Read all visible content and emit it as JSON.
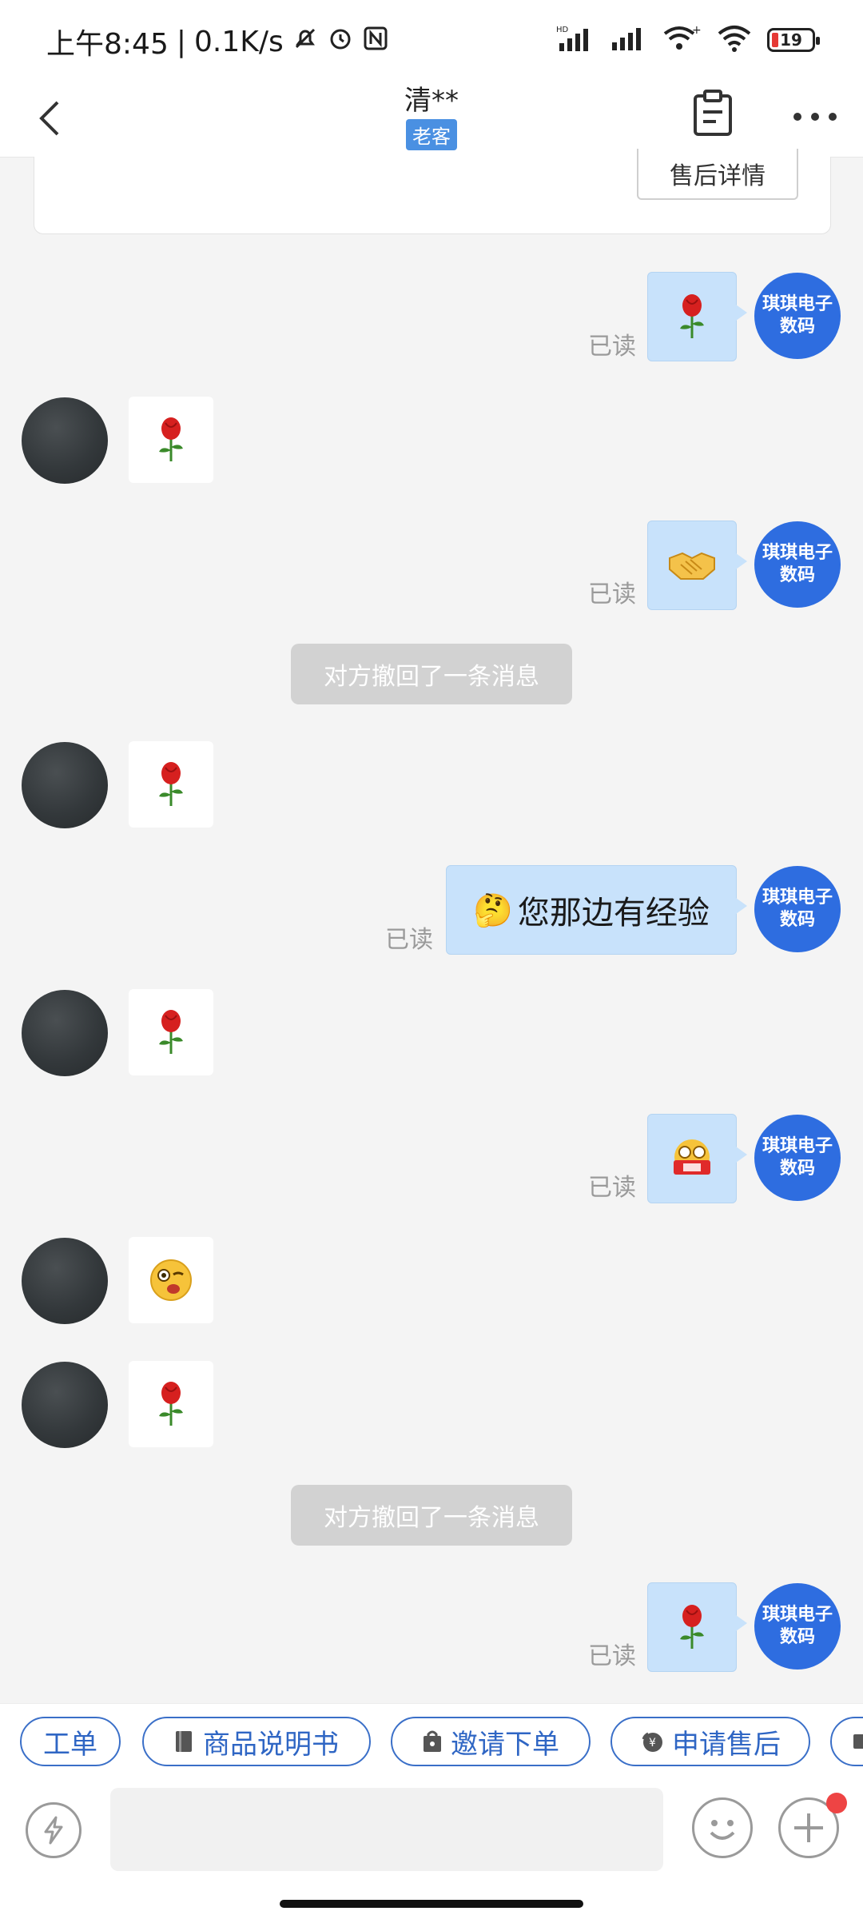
{
  "status_bar": {
    "time": "上午8:45",
    "speed": "0.1K/s",
    "network_label": "HD",
    "battery": "19"
  },
  "header": {
    "title": "清**",
    "badge": "老客"
  },
  "top_card": {
    "button_label": "售后详情"
  },
  "messages": {
    "me_avatar_line1": "琪琪电子",
    "me_avatar_line2": "数码",
    "read_label": "已读",
    "text_emoji": "🤔",
    "text_body": "您那边有经验",
    "system_text": "对方撤回了一条消息",
    "icons": {
      "rose": "rose-emoji",
      "handshake": "handshake-emoji",
      "money": "money-emoji",
      "wink": "wink-emoji"
    }
  },
  "chips": [
    {
      "label": "工单"
    },
    {
      "label": "商品说明书"
    },
    {
      "label": "邀请下单"
    },
    {
      "label": "申请售后"
    }
  ],
  "input": {
    "placeholder": ""
  },
  "colors": {
    "accent": "#2e6de0",
    "bubble_me": "#c8e2fb",
    "chip_blue": "#2f66c4",
    "badge_blue": "#4a90e2",
    "notification_dot": "#ee4444"
  }
}
